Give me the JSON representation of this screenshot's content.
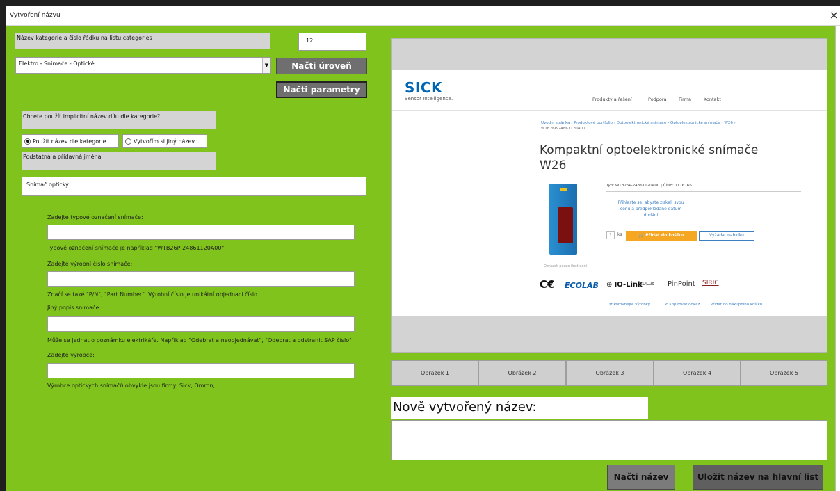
{
  "window": {
    "title": "Vytvoření názvu",
    "close_icon": "close-icon"
  },
  "category": {
    "label": "Název kategorie a číslo řádku  na listu categories",
    "row_number": "12",
    "selected": "Elektro - Snímače - Optické",
    "load_level_button": "Načti úroveň",
    "load_params_button": "Načti parametry"
  },
  "implicit_name": {
    "question": "Chcete použít implicitní název dílu dle kategorie?",
    "option_use": "Použít název dle kategorie",
    "option_custom": "Vytvořím si jiný název",
    "selected": "option_use"
  },
  "nouns": {
    "label": "Podstatná a přídavná jména",
    "value": "Snímač optický"
  },
  "fields": [
    {
      "label": "Zadejte typové označení snímače:",
      "value": "",
      "hint": "Typové označení snímače je například \"WTB26P-24861120A00\""
    },
    {
      "label": "Zadejte výrobní číslo snímače:",
      "value": "",
      "hint": "Značí se také \"P/N\", \"Part Number\". Výrobní číslo je unikátní objednací číslo"
    },
    {
      "label": "Jiný popis snímače:",
      "value": "",
      "hint": "Může se jednat o poznámku elektrikáře. Například \"Odebrat a neobjednávat\", \"Odebrat a odstranit SAP číslo\""
    },
    {
      "label": "Zadejte výrobce:",
      "value": "",
      "hint": "Výrobce optických snímačů obvykle jsou firmy: Sick, Omron, ..."
    }
  ],
  "preview": {
    "brand": "SICK",
    "brand_tagline": "Sensor Intelligence.",
    "nav": [
      "Produkty a řešení",
      "Podpora",
      "Firma",
      "Kontakt"
    ],
    "breadcrumb_line1": "Úvodní stránka › Produktové portfolio › Optoelektronické snímače › Optoelektronické snímače › W26 ›",
    "breadcrumb_line2": "WTB26P-24861120A00",
    "product_title_line1": "Kompaktní optoelektronické snímače",
    "product_title_line2": "W26",
    "type_line": "Typ: WTB26P-24861120A00 | Číslo: 1116766",
    "login_line1": "Přihlaste se, abyste získali svou",
    "login_line2": "cenu a předpokládané datum",
    "login_line3": "dodání",
    "qty": "1",
    "unit": "ks",
    "add_cart": "Přidat do košíku",
    "request_quote": "Vyžádat nabídku",
    "image_caption": "Obrázek pouze ilustrační",
    "cert_ce": "C€",
    "cert_ecolab": "ECOLAB",
    "cert_iolink": "IO-Link",
    "cert_ul": "cULus",
    "cert_pinpoint": "PinPoint",
    "cert_sirc": "SIRIC",
    "footer_compare": "Porovnejte výrobky",
    "footer_share": "Kopírovat odkaz",
    "footer_cart": "Přidat do nákupního košíku"
  },
  "image_buttons": [
    "Obrázek 1",
    "Obrázek 2",
    "Obrázek 3",
    "Obrázek 4",
    "Obrázek 5"
  ],
  "result": {
    "label": "Nově vytvořený název:",
    "value": "",
    "load_name_button": "Načti název",
    "save_button": "Uložit název na hlavní list"
  },
  "colors": {
    "form_bg": "#80c31c",
    "button_gray": "#6f6f6f",
    "sick_blue": "#0066b3",
    "cart_orange": "#f5a623"
  }
}
